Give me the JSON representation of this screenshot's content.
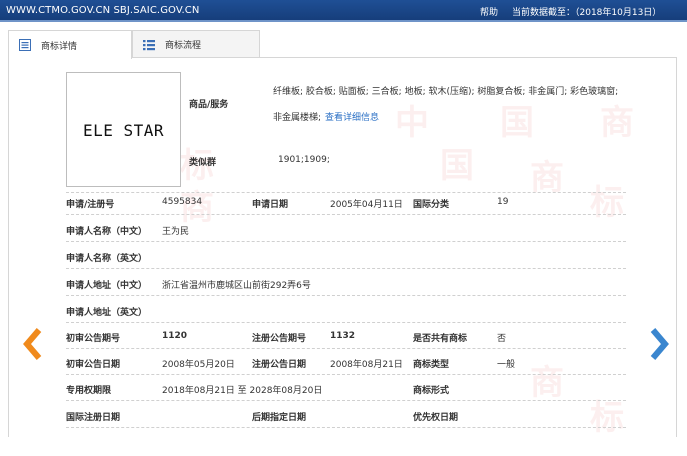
{
  "topbar": {
    "site": "WWW.CTMO.GOV.CN SBJ.SAIC.GOV.CN",
    "help": "帮助",
    "data_date": "当前数据截至：（2018年10月13日）"
  },
  "tabs": [
    {
      "label": "商标详情",
      "icon": "list-icon"
    },
    {
      "label": "商标流程",
      "icon": "flow-icon"
    }
  ],
  "watermark_chars": [
    "中",
    "国",
    "商",
    "标"
  ],
  "logo": {
    "text": "ELE STAR"
  },
  "goods": {
    "label": "商品/服务",
    "text1": "纤维板; 胶合板; 贴面板; 三合板; 地板; 软木(压缩); 树脂复合板; 非金属门; 彩色玻璃窗;",
    "text2": "非金属楼梯;",
    "link": "查看详细信息"
  },
  "similar": {
    "label": "类似群",
    "value": "1901;1909;"
  },
  "rows": {
    "reg_no_label": "申请/注册号",
    "reg_no": "4595834",
    "apply_date_label": "申请日期",
    "apply_date": "2005年04月11日",
    "intl_class_label": "国际分类",
    "intl_class": "19",
    "applicant_cn_label": "申请人名称（中文）",
    "applicant_cn": "王为民",
    "applicant_en_label": "申请人名称（英文）",
    "addr_cn_label": "申请人地址（中文）",
    "addr_cn": "浙江省温州市鹿城区山前街292弄6号",
    "addr_en_label": "申请人地址（英文）",
    "prelim_no_label": "初审公告期号",
    "prelim_no": "1120",
    "reg_pub_no_label": "注册公告期号",
    "reg_pub_no": "1132",
    "shared_label": "是否共有商标",
    "shared": "否",
    "prelim_date_label": "初审公告日期",
    "prelim_date": "2008年05月20日",
    "reg_pub_date_label": "注册公告日期",
    "reg_pub_date": "2008年08月21日",
    "mark_type_label": "商标类型",
    "mark_type": "一般",
    "exclusive_label": "专用权期限",
    "exclusive": "2018年08月21日 至 2028年08月20日",
    "mark_form_label": "商标形式",
    "intl_reg_date_label": "国际注册日期",
    "later_date_label": "后期指定日期",
    "priority_date_label": "优先权日期"
  },
  "colors": {
    "arrow_left": "#f08a1c",
    "arrow_right": "#3a86cf",
    "topbar": "#1f4f95",
    "link": "#2a6fc4"
  }
}
